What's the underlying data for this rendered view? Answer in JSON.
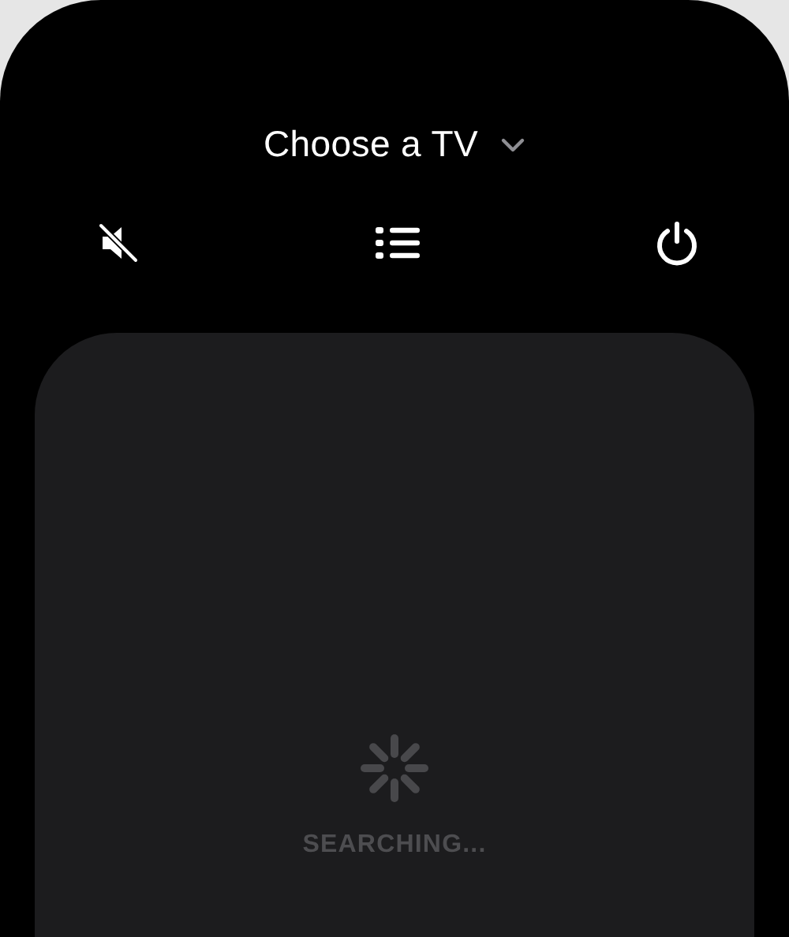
{
  "header": {
    "title": "Choose a TV"
  },
  "touchpad": {
    "status": "SEARCHING..."
  }
}
